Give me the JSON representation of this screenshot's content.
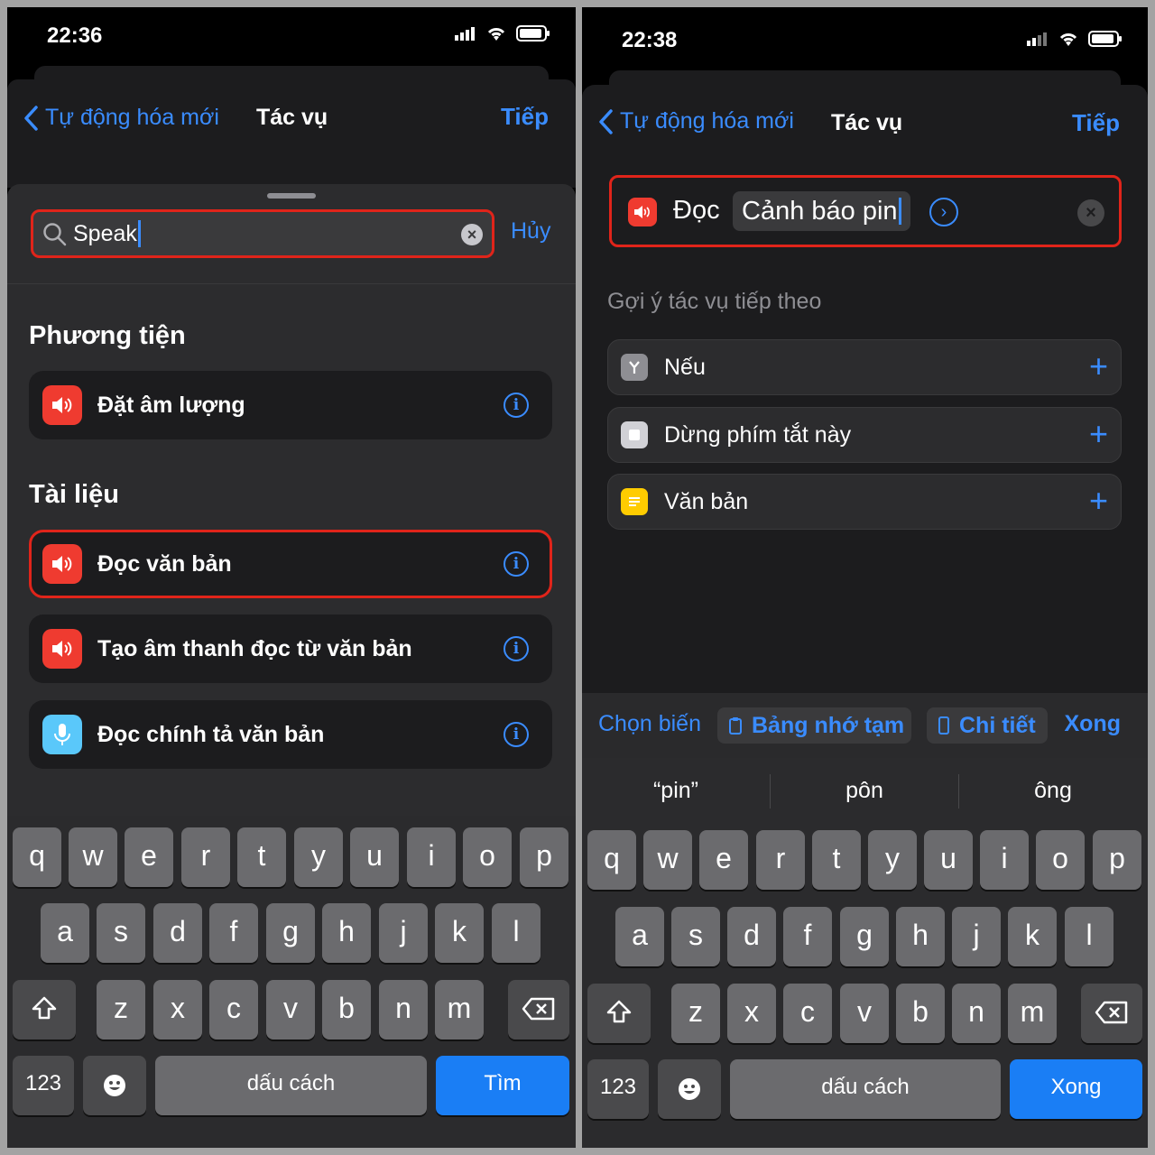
{
  "left": {
    "status_time": "22:36",
    "nav": {
      "back": "Tự động hóa mới",
      "title": "Tác vụ",
      "next": "Tiếp"
    },
    "search": {
      "value": "Speak",
      "cancel": "Hủy"
    },
    "sections": [
      {
        "title": "Phương tiện",
        "items": [
          {
            "label": "Đặt âm lượng"
          }
        ]
      },
      {
        "title": "Tài liệu",
        "items": [
          {
            "label": "Đọc văn bản"
          },
          {
            "label": "Tạo âm thanh đọc từ văn bản"
          },
          {
            "label": "Đọc chính tả văn bản"
          }
        ]
      }
    ],
    "keyboard": {
      "numbers": "123",
      "space": "dấu cách",
      "action": "Tìm"
    }
  },
  "right": {
    "status_time": "22:38",
    "nav": {
      "back": "Tự động hóa mới",
      "title": "Tác vụ",
      "next": "Tiếp"
    },
    "action": {
      "verb": "Đọc",
      "param": "Cảnh báo pin"
    },
    "suggest_title": "Gợi ý tác vụ tiếp theo",
    "suggestions": [
      {
        "label": "Nếu"
      },
      {
        "label": "Dừng phím tắt này"
      },
      {
        "label": "Văn bản"
      }
    ],
    "varbar": {
      "choose": "Chọn biến",
      "clipboard": "Bảng nhớ tạm",
      "details": "Chi tiết",
      "done": "Xong"
    },
    "predictions": [
      "“pin”",
      "pôn",
      "ông"
    ],
    "keyboard": {
      "numbers": "123",
      "space": "dấu cách",
      "action": "Xong"
    }
  },
  "keys": {
    "row1": [
      "q",
      "w",
      "e",
      "r",
      "t",
      "y",
      "u",
      "i",
      "o",
      "p"
    ],
    "row2": [
      "a",
      "s",
      "d",
      "f",
      "g",
      "h",
      "j",
      "k",
      "l"
    ],
    "row3": [
      "z",
      "x",
      "c",
      "v",
      "b",
      "n",
      "m"
    ]
  },
  "colors": {
    "accent": "#3a8cff",
    "highlight": "#e0241a",
    "speak_icon": "#ef3b30",
    "action_key": "#1a7ef5"
  }
}
